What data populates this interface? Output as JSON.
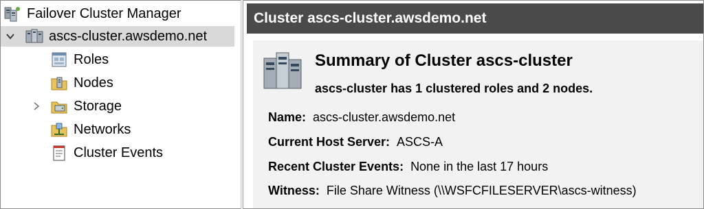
{
  "tree": {
    "root": {
      "label": "Failover Cluster Manager",
      "icon": "cluster-manager-icon"
    },
    "cluster": {
      "label": "ascs-cluster.awsdemo.net",
      "icon": "cluster-icon",
      "expanded": true,
      "selected": true
    },
    "children": [
      {
        "label": "Roles",
        "icon": "roles-icon"
      },
      {
        "label": "Nodes",
        "icon": "nodes-icon"
      },
      {
        "label": "Storage",
        "icon": "storage-icon"
      },
      {
        "label": "Networks",
        "icon": "networks-icon"
      },
      {
        "label": "Cluster Events",
        "icon": "cluster-events-icon"
      }
    ]
  },
  "panel": {
    "header": "Cluster ascs-cluster.awsdemo.net",
    "summary_title": "Summary of Cluster ascs-cluster",
    "summary_subtitle": "ascs-cluster has 1 clustered roles and 2 nodes.",
    "details": [
      {
        "key": "Name:",
        "value": "ascs-cluster.awsdemo.net"
      },
      {
        "key": "Current Host Server:",
        "value": "ASCS-A"
      },
      {
        "key": "Recent Cluster Events:",
        "value": "None in the last 17 hours"
      },
      {
        "key": "Witness:",
        "value": "File Share Witness (\\\\WSFCFILESERVER\\ascs-witness)"
      }
    ]
  },
  "colors": {
    "header_bg": "#4a4a4a",
    "selected_bg": "#d9d9d9",
    "content_bg": "#f2f2f2"
  }
}
